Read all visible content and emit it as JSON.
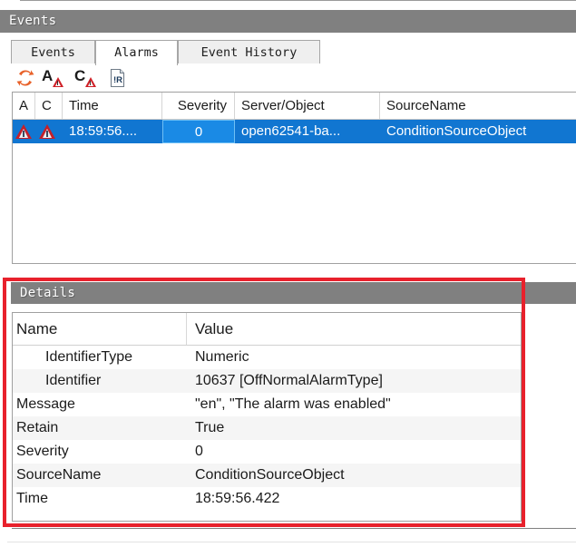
{
  "window": {
    "events_panel_title": "Events",
    "details_panel_title": "Details"
  },
  "tabs": [
    {
      "label": "Events",
      "active": false
    },
    {
      "label": "Alarms",
      "active": true
    },
    {
      "label": "Event History",
      "active": false
    }
  ],
  "toolbar": {
    "buttons": [
      {
        "name": "refresh-icon",
        "tooltip": "Refresh",
        "glyph": ""
      },
      {
        "name": "acknowledge-alarm-icon",
        "letter": "A"
      },
      {
        "name": "confirm-alarm-icon",
        "letter": "C"
      },
      {
        "name": "report-icon",
        "letter": "!R"
      }
    ]
  },
  "events_grid": {
    "columns": [
      {
        "key": "a",
        "label": "A"
      },
      {
        "key": "c",
        "label": "C"
      },
      {
        "key": "time",
        "label": "Time"
      },
      {
        "key": "severity",
        "label": "Severity"
      },
      {
        "key": "server_object",
        "label": "Server/Object"
      },
      {
        "key": "source_name",
        "label": "SourceName"
      }
    ],
    "rows": [
      {
        "a": "alarm-warning-icon",
        "c": "alarm-warning-icon",
        "time": "18:59:56....",
        "severity": "0",
        "server_object": "open62541-ba...",
        "source_name": "ConditionSourceObject",
        "selected": true
      }
    ]
  },
  "details": {
    "columns": {
      "name": "Name",
      "value": "Value"
    },
    "rows": [
      {
        "name": "IdentifierType",
        "value": "Numeric",
        "indent": true,
        "alt": false
      },
      {
        "name": "Identifier",
        "value": "10637 [OffNormalAlarmType]",
        "indent": true,
        "alt": true
      },
      {
        "name": "Message",
        "value": "\"en\", \"The alarm was enabled\"",
        "indent": false,
        "alt": false
      },
      {
        "name": "Retain",
        "value": "True",
        "indent": false,
        "alt": true
      },
      {
        "name": "Severity",
        "value": "0",
        "indent": false,
        "alt": false
      },
      {
        "name": "SourceName",
        "value": "ConditionSourceObject",
        "indent": false,
        "alt": true
      },
      {
        "name": "Time",
        "value": "18:59:56.422",
        "indent": false,
        "alt": false
      }
    ]
  },
  "colors": {
    "panel_header_bg": "#808080",
    "selection_blue": "#1176d1",
    "focused_cell_blue": "#1a8ae5",
    "highlight_red": "#e8212c",
    "warning_red": "#c4202a",
    "refresh_orange": "#e8622a"
  }
}
